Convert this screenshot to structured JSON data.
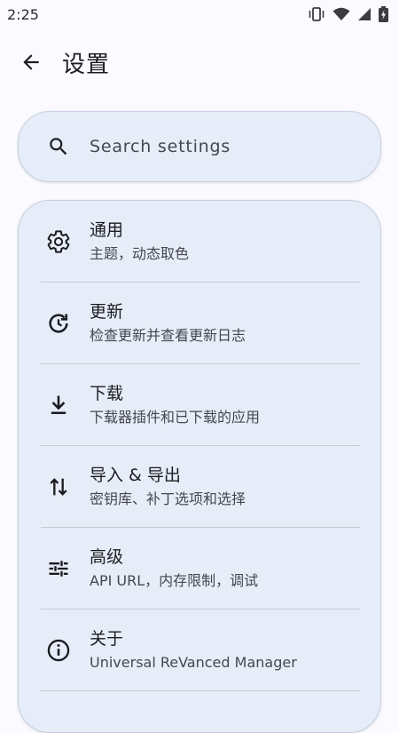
{
  "status_bar": {
    "time": "2:25",
    "icons": [
      "vibrate-icon",
      "wifi-icon",
      "signal-icon",
      "battery-charging-icon"
    ]
  },
  "app_bar": {
    "back_icon": "arrow-back-icon",
    "title": "设置"
  },
  "search": {
    "icon": "search-icon",
    "placeholder": "Search settings"
  },
  "settings": {
    "items": [
      {
        "icon": "gear-icon",
        "title": "通用",
        "subtitle": "主题，动态取色"
      },
      {
        "icon": "update-icon",
        "title": "更新",
        "subtitle": "检查更新并查看更新日志"
      },
      {
        "icon": "download-icon",
        "title": "下载",
        "subtitle": "下载器插件和已下载的应用"
      },
      {
        "icon": "import-export-icon",
        "title": "导入 & 导出",
        "subtitle": "密钥库、补丁选项和选择"
      },
      {
        "icon": "tune-icon",
        "title": "高级",
        "subtitle": "API URL，内存限制，调试"
      },
      {
        "icon": "info-icon",
        "title": "关于",
        "subtitle": "Universal ReVanced Manager"
      }
    ]
  },
  "colors": {
    "background": "#fbfbff",
    "card": "#e7edf8",
    "card_border": "#c6d0e2",
    "text_primary": "#1b1c20",
    "text_secondary": "#44474f"
  }
}
